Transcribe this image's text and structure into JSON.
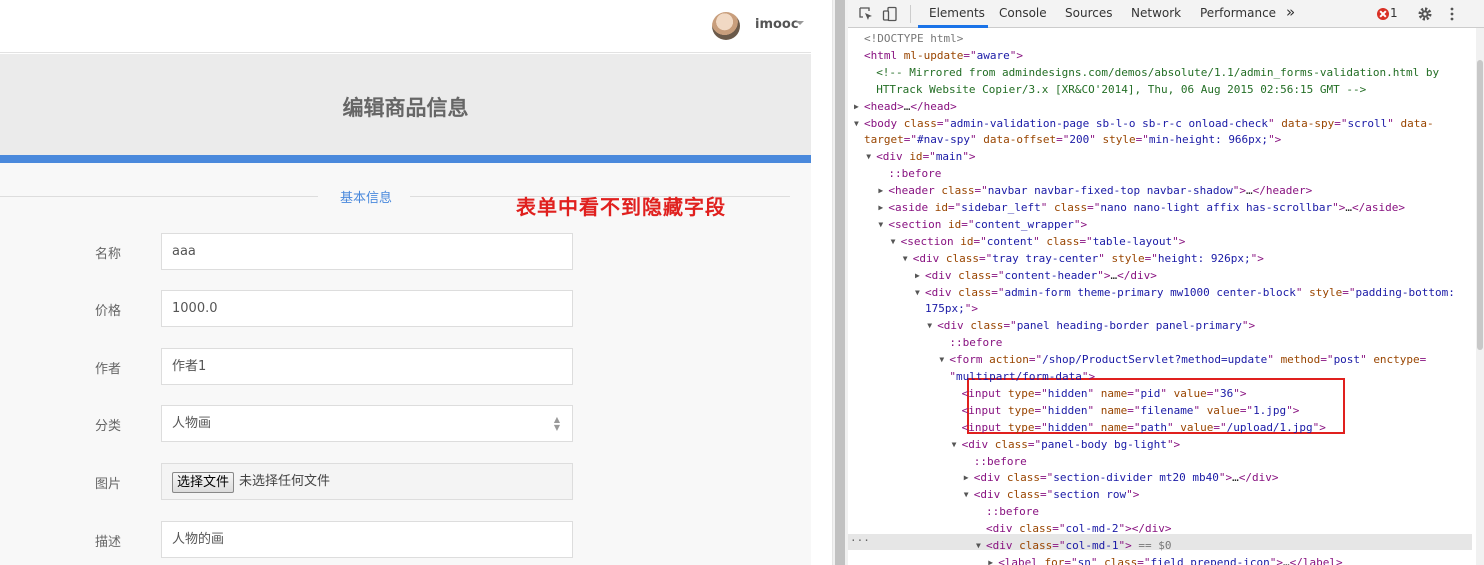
{
  "header": {
    "username": "imooc"
  },
  "page": {
    "title": "编辑商品信息",
    "section_label": "基本信息",
    "annotation": "表单中看不到隐藏字段"
  },
  "form": {
    "fields": [
      {
        "label": "名称",
        "value": "aaa"
      },
      {
        "label": "价格",
        "value": "1000.0"
      },
      {
        "label": "作者",
        "value": "作者1"
      },
      {
        "label": "分类",
        "value": "人物画"
      },
      {
        "label": "图片",
        "button": "选择文件",
        "status": "未选择任何文件"
      },
      {
        "label": "描述",
        "value": "人物的画"
      }
    ]
  },
  "devtools": {
    "tabs": [
      "Elements",
      "Console",
      "Sources",
      "Network",
      "Performance"
    ],
    "more": "»",
    "error_count": "1",
    "code": [
      {
        "indent": 0,
        "tri": "",
        "html": "<span class=\"g\">&lt;!DOCTYPE html&gt;</span>"
      },
      {
        "indent": 0,
        "tri": "",
        "html": "&lt;html <span class=\"a\">ml-update</span>=\"<span class=\"v\">aware</span>\"&gt;"
      },
      {
        "indent": 1,
        "tri": "",
        "html": "<span class=\"c\">&lt;!-- Mirrored from admindesigns.com/demos/absolute/1.1/admin_forms-validation.html by</span>"
      },
      {
        "indent": 1,
        "tri": "",
        "html": "<span class=\"c\">HTTrack Website Copier/3.x [XR&amp;CO'2014], Thu, 06 Aug 2015 02:56:15 GMT --&gt;</span>"
      },
      {
        "indent": 0,
        "tri": "▶",
        "html": "&lt;head&gt;<span class=\"p\">…</span>&lt;/head&gt;"
      },
      {
        "indent": 0,
        "tri": "▼",
        "html": "&lt;body <span class=\"a\">class</span>=\"<span class=\"v\">admin-validation-page sb-l-o sb-r-c onload-check</span>\" <span class=\"a\">data-spy</span>=\"<span class=\"v\">scroll</span>\" <span class=\"a\">data-</span>"
      },
      {
        "indent": 0,
        "tri": "",
        "html": "<span class=\"a\">target</span>=\"<span class=\"v\">#nav-spy</span>\" <span class=\"a\">data-offset</span>=\"<span class=\"v\">200</span>\" <span class=\"a\">style</span>=\"<span class=\"v\">min-height: 966px;</span>\"&gt;"
      },
      {
        "indent": 1,
        "tri": "▼",
        "html": "&lt;div <span class=\"a\">id</span>=\"<span class=\"v\">main</span>\"&gt;"
      },
      {
        "indent": 2,
        "tri": "",
        "html": "::before"
      },
      {
        "indent": 2,
        "tri": "▶",
        "html": "&lt;header <span class=\"a\">class</span>=\"<span class=\"v\">navbar navbar-fixed-top navbar-shadow</span>\"&gt;<span class=\"p\">…</span>&lt;/header&gt;"
      },
      {
        "indent": 2,
        "tri": "▶",
        "html": "&lt;aside <span class=\"a\">id</span>=\"<span class=\"v\">sidebar_left</span>\" <span class=\"a\">class</span>=\"<span class=\"v\">nano nano-light affix has-scrollbar</span>\"&gt;<span class=\"p\">…</span>&lt;/aside&gt;"
      },
      {
        "indent": 2,
        "tri": "▼",
        "html": "&lt;section <span class=\"a\">id</span>=\"<span class=\"v\">content_wrapper</span>\"&gt;"
      },
      {
        "indent": 3,
        "tri": "▼",
        "html": "&lt;section <span class=\"a\">id</span>=\"<span class=\"v\">content</span>\" <span class=\"a\">class</span>=\"<span class=\"v\">table-layout</span>\"&gt;"
      },
      {
        "indent": 4,
        "tri": "▼",
        "html": "&lt;div <span class=\"a\">class</span>=\"<span class=\"v\">tray tray-center</span>\" <span class=\"a\">style</span>=\"<span class=\"v\">height: 926px;</span>\"&gt;"
      },
      {
        "indent": 5,
        "tri": "▶",
        "html": "&lt;div <span class=\"a\">class</span>=\"<span class=\"v\">content-header</span>\"&gt;<span class=\"p\">…</span>&lt;/div&gt;"
      },
      {
        "indent": 5,
        "tri": "▼",
        "html": "&lt;div <span class=\"a\">class</span>=\"<span class=\"v\">admin-form theme-primary mw1000 center-block</span>\" <span class=\"a\">style</span>=\"<span class=\"v\">padding-bottom:</span>"
      },
      {
        "indent": 5,
        "tri": "",
        "html": "<span class=\"v\">175px;</span>\"&gt;"
      },
      {
        "indent": 6,
        "tri": "▼",
        "html": "&lt;div <span class=\"a\">class</span>=\"<span class=\"v\">panel heading-border panel-primary</span>\"&gt;"
      },
      {
        "indent": 7,
        "tri": "",
        "html": "::before"
      },
      {
        "indent": 7,
        "tri": "▼",
        "html": "&lt;form <span class=\"a\">action</span>=\"<span class=\"v\">/shop/ProductServlet?method=update</span>\" <span class=\"a\">method</span>=\"<span class=\"v\">post</span>\" <span class=\"a\">enctype</span>="
      },
      {
        "indent": 7,
        "tri": "",
        "html": "\"<span class=\"v\">multipart/form-data</span>\"&gt;"
      },
      {
        "indent": 8,
        "tri": "",
        "html": "&lt;input <span class=\"a\">type</span>=\"<span class=\"v\">hidden</span>\" <span class=\"a\">name</span>=\"<span class=\"v\">pid</span>\" <span class=\"a\">value</span>=\"<span class=\"v\">36</span>\"&gt;"
      },
      {
        "indent": 8,
        "tri": "",
        "html": "&lt;input <span class=\"a\">type</span>=\"<span class=\"v\">hidden</span>\" <span class=\"a\">name</span>=\"<span class=\"v\">filename</span>\" <span class=\"a\">value</span>=\"<span class=\"v\">1.jpg</span>\"&gt;"
      },
      {
        "indent": 8,
        "tri": "",
        "html": "&lt;input <span class=\"a\">type</span>=\"<span class=\"v\">hidden</span>\" <span class=\"a\">name</span>=\"<span class=\"v\">path</span>\" <span class=\"a\">value</span>=\"<span class=\"v\">/upload/1.jpg</span>\"&gt;"
      },
      {
        "indent": 8,
        "tri": "▼",
        "html": "&lt;div <span class=\"a\">class</span>=\"<span class=\"v\">panel-body bg-light</span>\"&gt;"
      },
      {
        "indent": 9,
        "tri": "",
        "html": "::before"
      },
      {
        "indent": 9,
        "tri": "▶",
        "html": "&lt;div <span class=\"a\">class</span>=\"<span class=\"v\">section-divider mt20 mb40</span>\"&gt;<span class=\"p\">…</span>&lt;/div&gt;"
      },
      {
        "indent": 9,
        "tri": "▼",
        "html": "&lt;div <span class=\"a\">class</span>=\"<span class=\"v\">section row</span>\"&gt;"
      },
      {
        "indent": 10,
        "tri": "",
        "html": "::before"
      },
      {
        "indent": 10,
        "tri": "",
        "html": "&lt;div <span class=\"a\">class</span>=\"<span class=\"v\">col-md-2</span>\"&gt;&lt;/div&gt;"
      },
      {
        "indent": 10,
        "tri": "▼",
        "html": "&lt;div <span class=\"a\">class</span>=\"<span class=\"v\">col-md-1</span>\"&gt; <span class=\"g\">== $0</span>"
      },
      {
        "indent": 11,
        "tri": "▶",
        "html": "&lt;label <span class=\"a\">for</span>=\"<span class=\"v\">sn</span>\" <span class=\"a\">class</span>=\"<span class=\"v\">field prepend-icon</span>\"&gt;<span class=\"p\">…</span>&lt;/label&gt;"
      }
    ]
  }
}
